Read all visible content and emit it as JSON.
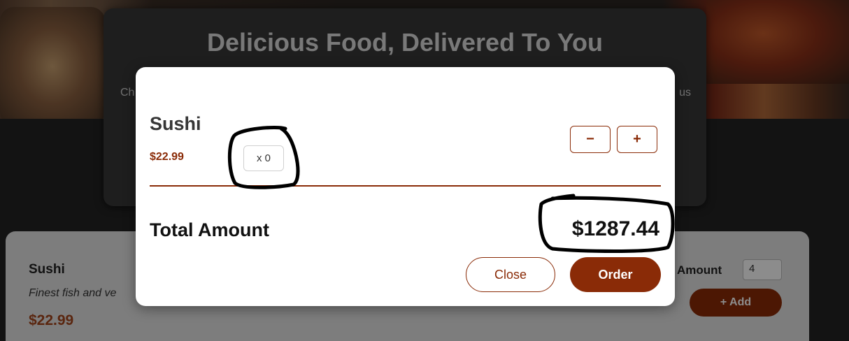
{
  "summary": {
    "title": "Delicious Food, Delivered To You",
    "text_left": "Ch",
    "text_right": "us"
  },
  "meal": {
    "name": "Sushi",
    "description": "Finest fish and ve",
    "price": "$22.99",
    "amount_label": "Amount",
    "amount_value": "4",
    "add_label": "+ Add"
  },
  "cart": {
    "item": {
      "name": "Sushi",
      "price": "$22.99",
      "quantity": "x 0",
      "minus_label": "−",
      "plus_label": "+"
    },
    "total_label": "Total Amount",
    "total_value": "$1287.44",
    "close_label": "Close",
    "order_label": "Order"
  },
  "colors": {
    "accent": "#8a2b07",
    "annotation": "#000000"
  }
}
